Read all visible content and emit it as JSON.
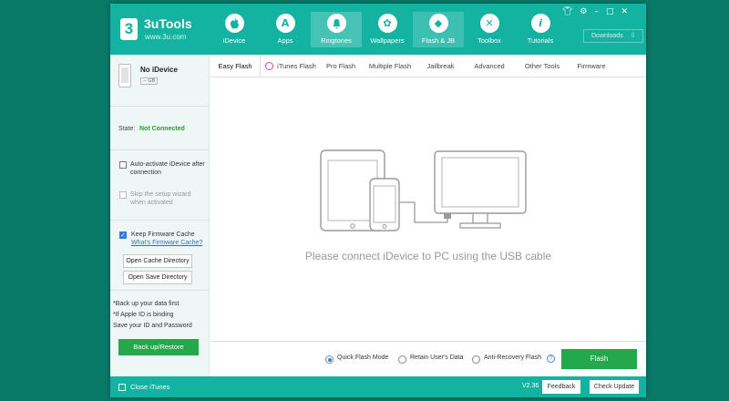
{
  "app": {
    "name": "3uTools",
    "url": "www.3u.com",
    "logo_text": "3"
  },
  "nav": [
    {
      "label": "iDevice",
      "icon": "apple-icon",
      "glyph": ""
    },
    {
      "label": "Apps",
      "icon": "apps-icon",
      "glyph": "A"
    },
    {
      "label": "Ringtones",
      "icon": "bell-icon",
      "glyph": "♪"
    },
    {
      "label": "Wallpapers",
      "icon": "flower-icon",
      "glyph": "✿"
    },
    {
      "label": "Flash & JB",
      "icon": "dropbox-icon",
      "glyph": "◆"
    },
    {
      "label": "Toolbox",
      "icon": "tools-icon",
      "glyph": "✕"
    },
    {
      "label": "Tutorials",
      "icon": "info-icon",
      "glyph": "i"
    }
  ],
  "active_nav": "Ringtones",
  "window_controls": [
    "shirt-icon",
    "gear-icon",
    "minimize-icon",
    "maximize-icon",
    "close-icon"
  ],
  "downloads_label": "Downloads",
  "device": {
    "name": "No iDevice",
    "capacity": "-- GB",
    "state_label": "State:",
    "state_value": "Not Connected",
    "state_color": "#21a038"
  },
  "options": {
    "auto_activate": "Auto-activate iDevice after connection",
    "skip_setup": "Skip the setup wizard when activated",
    "keep_cache": "Keep Firmware Cache",
    "whats_cache": "What's Firmware Cache?",
    "open_cache_dir": "Open Cache Directory",
    "open_save_dir": "Open Save Directory"
  },
  "notes": [
    "*Back up your data first",
    "*If Apple ID is binding",
    "Save your ID and Password"
  ],
  "backup_button": "Back up/Restore",
  "tabs": [
    "Easy Flash",
    "iTunes Flash",
    "Pro Flash",
    "Multiple Flash",
    "Jailbreak",
    "Advanced",
    "Other Tools",
    "Firmware"
  ],
  "active_tab": "Easy Flash",
  "main_message": "Please connect iDevice to PC using the USB cable",
  "flash_modes": [
    {
      "label": "Quick Flash Mode",
      "selected": true
    },
    {
      "label": "Retain User's Data",
      "selected": false
    },
    {
      "label": "Anti-Recovery Flash",
      "selected": false
    }
  ],
  "flash_button": "Flash",
  "bottom": {
    "close_itunes": "Close iTunes",
    "version": "V2.36",
    "feedback": "Feedback",
    "check_update": "Check Update"
  },
  "colors": {
    "accent": "#13b2a1",
    "green_button": "#23a84b",
    "background": "#0a7a68"
  }
}
